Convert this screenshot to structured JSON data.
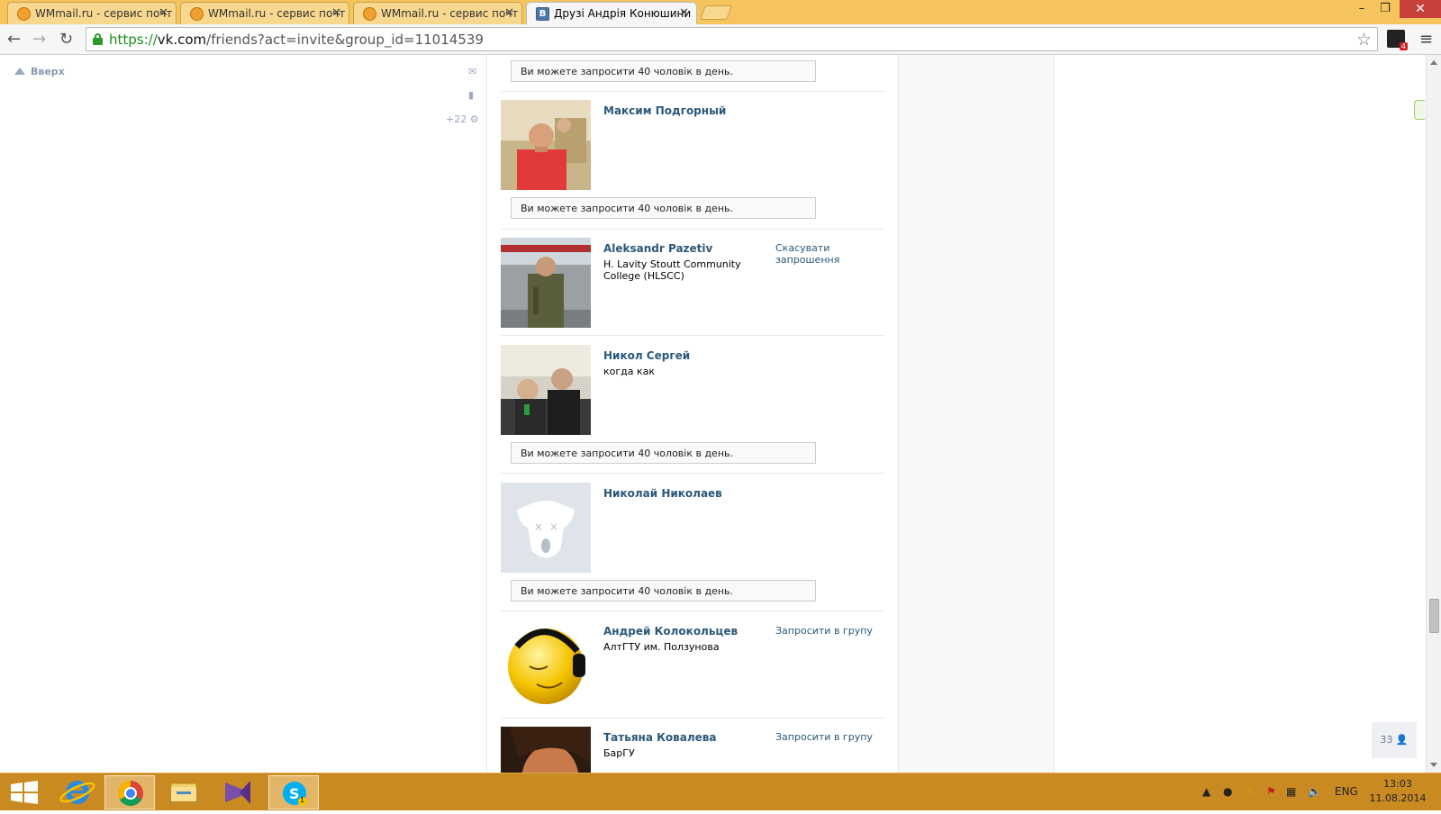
{
  "browser": {
    "tabs": [
      {
        "title": "WMmail.ru - сервис почт",
        "favicon": "wmmail-icon",
        "active": false
      },
      {
        "title": "WMmail.ru - сервис почт",
        "favicon": "wmmail-icon",
        "active": false
      },
      {
        "title": "WMmail.ru - сервис почт",
        "favicon": "wmmail-icon",
        "active": false
      },
      {
        "title": "Друзі Андрія Конюшини",
        "favicon": "vk-icon",
        "active": true
      }
    ],
    "url": {
      "scheme": "https://",
      "host": "vk.com",
      "path": "/friends?act=invite&group_id=11014539"
    },
    "extension_badge": "4"
  },
  "left_panel": {
    "up_link": "Вверх",
    "notifications_count": "+22"
  },
  "limit_notice": "Ви можете запросити 40 чоловік в день.",
  "friends": [
    {
      "name": "Максим Подгорный",
      "info": "",
      "action": "",
      "avatar": "photo-man-red-shirt"
    },
    {
      "name": "Aleksandr Pazetiv",
      "info": "H. Lavity Stoutt Community College (HLSCC)",
      "action": "Скасувати запрошення",
      "avatar": "photo-man-camouflage"
    },
    {
      "name": "Никол Сергей",
      "info": "когда как",
      "action": "",
      "avatar": "photo-two-people-bus"
    },
    {
      "name": "Николай Николаев",
      "info": "",
      "action": "",
      "avatar": "vk-deactivated-dog-icon"
    },
    {
      "name": "Андрей Колокольцев",
      "info": "АлтГТУ им. Ползунова",
      "action": "Запросити в групу",
      "avatar": "yellow-smiley-headphones"
    },
    {
      "name": "Татьяна Ковалева",
      "info": "БарГУ",
      "action": "Запросити в групу",
      "avatar": "photo-woman"
    }
  ],
  "friends_counter": "33",
  "taskbar": {
    "language": "ENG",
    "time": "13:03",
    "date": "11.08.2014",
    "skype_badge": "1"
  }
}
